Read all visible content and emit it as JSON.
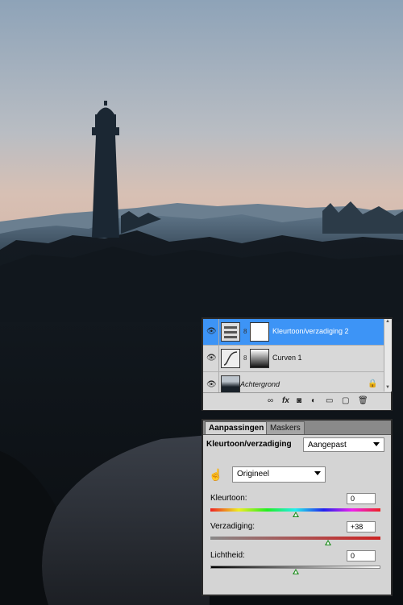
{
  "layers_panel": {
    "layers": [
      {
        "name": "Kleurtoon/verzadiging 2",
        "selected": true,
        "visible": true,
        "icon": "hue-saturation-icon"
      },
      {
        "name": "Curven 1",
        "selected": false,
        "visible": true,
        "icon": "curves-icon"
      },
      {
        "name": "Achtergrond",
        "selected": false,
        "visible": true,
        "icon": "photo-thumbnail",
        "locked": true
      }
    ],
    "footer_icons": [
      "link-layers-icon",
      "fx-icon",
      "mask-icon",
      "adjustment-icon",
      "folder-icon",
      "new-layer-icon",
      "trash-icon"
    ],
    "fx_label": "fx"
  },
  "adjustments_panel": {
    "tabs": [
      {
        "label": "Aanpassingen",
        "active": true
      },
      {
        "label": "Maskers",
        "active": false
      }
    ],
    "title": "Kleurtoon/verzadiging",
    "preset_select": "Aangepast",
    "channel_select": "Origineel",
    "params": [
      {
        "label": "Kleurtoon:",
        "value": "0",
        "level": 0.5
      },
      {
        "label": "Verzadiging:",
        "value": "+38",
        "level": 0.69
      },
      {
        "label": "Lichtheid:",
        "value": "0",
        "level": 0.5
      }
    ]
  },
  "colors": {
    "selection": "#3d94f6",
    "knob": "#1a8a1a",
    "saturation_track": "#cc2222"
  }
}
